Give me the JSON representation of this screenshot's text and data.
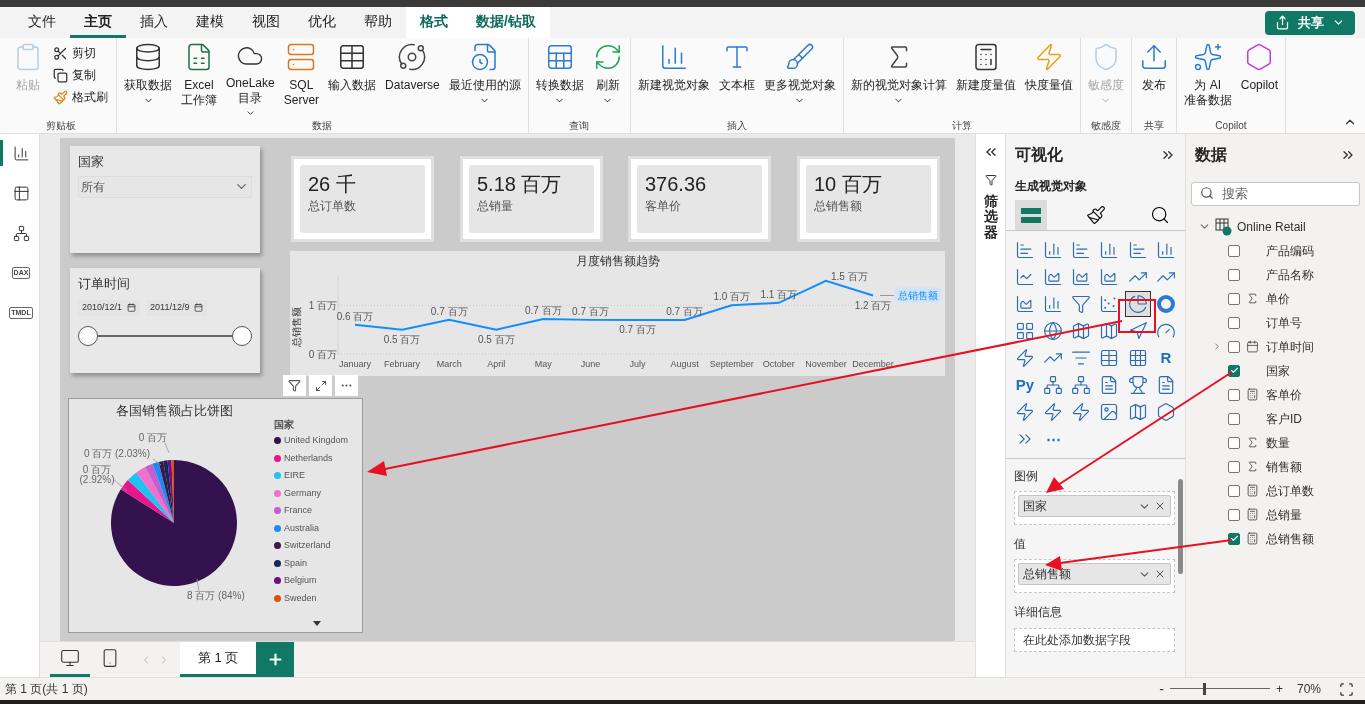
{
  "ribbon_tabs": [
    {
      "label": "文件",
      "kind": "normal",
      "selected": false
    },
    {
      "label": "主页",
      "kind": "normal",
      "selected": true
    },
    {
      "label": "插入",
      "kind": "normal",
      "selected": false
    },
    {
      "label": "建模",
      "kind": "normal",
      "selected": false
    },
    {
      "label": "视图",
      "kind": "normal",
      "selected": false
    },
    {
      "label": "优化",
      "kind": "normal",
      "selected": false
    },
    {
      "label": "帮助",
      "kind": "normal",
      "selected": false
    },
    {
      "label": "格式",
      "kind": "contextual",
      "selected": false
    },
    {
      "label": "数据/钻取",
      "kind": "contextual",
      "selected": false
    }
  ],
  "share_button": {
    "label": "共享"
  },
  "ribbon_groups": [
    {
      "label": "剪贴板",
      "buttons": [
        {
          "label": "粘贴",
          "kind": "large",
          "dropdown": false,
          "disabled": true
        },
        {
          "label": "剪切",
          "kind": "small",
          "dropdown": false,
          "disabled": false
        },
        {
          "label": "复制",
          "kind": "small",
          "dropdown": false,
          "disabled": false
        },
        {
          "label": "格式刷",
          "kind": "small",
          "dropdown": false,
          "disabled": false
        }
      ]
    },
    {
      "label": "数据",
      "buttons": [
        {
          "label": "获取数据",
          "kind": "large",
          "dropdown": true,
          "disabled": false
        },
        {
          "label": "Excel\n工作簿",
          "kind": "large",
          "dropdown": false,
          "disabled": false
        },
        {
          "label": "OneLake\n目录",
          "kind": "large",
          "dropdown": true,
          "disabled": false
        },
        {
          "label": "SQL\nServer",
          "kind": "large",
          "dropdown": false,
          "disabled": false
        },
        {
          "label": "输入数据",
          "kind": "large",
          "dropdown": false,
          "disabled": false
        },
        {
          "label": "Dataverse",
          "kind": "large",
          "dropdown": false,
          "disabled": false
        },
        {
          "label": "最近使用的源",
          "kind": "large",
          "dropdown": true,
          "disabled": false
        }
      ]
    },
    {
      "label": "查询",
      "buttons": [
        {
          "label": "转换数据",
          "kind": "large",
          "dropdown": true,
          "disabled": false
        },
        {
          "label": "刷新",
          "kind": "large",
          "dropdown": true,
          "disabled": false
        }
      ]
    },
    {
      "label": "插入",
      "buttons": [
        {
          "label": "新建视觉对象",
          "kind": "large",
          "dropdown": false,
          "disabled": false
        },
        {
          "label": "文本框",
          "kind": "large",
          "dropdown": false,
          "disabled": false
        },
        {
          "label": "更多视觉对象",
          "kind": "large",
          "dropdown": true,
          "disabled": false
        }
      ]
    },
    {
      "label": "计算",
      "buttons": [
        {
          "label": "新的视觉对象计算",
          "kind": "large",
          "dropdown": true,
          "disabled": false
        },
        {
          "label": "新建度量值",
          "kind": "large",
          "dropdown": false,
          "disabled": false
        },
        {
          "label": "快度量值",
          "kind": "large",
          "dropdown": false,
          "disabled": false
        }
      ]
    },
    {
      "label": "敏感度",
      "buttons": [
        {
          "label": "敏感度",
          "kind": "large",
          "dropdown": true,
          "disabled": true
        }
      ]
    },
    {
      "label": "共享",
      "buttons": [
        {
          "label": "发布",
          "kind": "large",
          "dropdown": false,
          "disabled": false
        }
      ]
    },
    {
      "label": "Copilot",
      "buttons": [
        {
          "label": "为 AI\n准备数据",
          "kind": "large",
          "dropdown": false,
          "disabled": false
        },
        {
          "label": "Copilot",
          "kind": "large",
          "dropdown": false,
          "disabled": false
        }
      ]
    }
  ],
  "view_rail": [
    {
      "kind": "report",
      "selected": true
    },
    {
      "kind": "table",
      "selected": false
    },
    {
      "kind": "model",
      "selected": false
    },
    {
      "kind": "dax",
      "label": "DAX",
      "selected": false
    },
    {
      "kind": "tmdl",
      "label": "TMDL",
      "selected": false
    }
  ],
  "slicers": [
    {
      "kind": "dropdown",
      "title": "国家",
      "value": "所有"
    },
    {
      "kind": "range",
      "title": "订单时间",
      "start": "2010/12/1",
      "end": "2011/12/9",
      "handles": [
        {
          "level": 0
        },
        {
          "level": 1
        }
      ]
    }
  ],
  "cards": [
    {
      "value": "26 千",
      "label": "总订单数"
    },
    {
      "value": "5.18 百万",
      "label": "总销量"
    },
    {
      "value": "376.36",
      "label": "客单价"
    },
    {
      "value": "10 百万",
      "label": "总销售额"
    }
  ],
  "line_chart": {
    "chart_data": {
      "type": "line",
      "title": "月度销售额趋势",
      "ylabel": "总销售额",
      "categories": [
        "January",
        "February",
        "March",
        "April",
        "May",
        "June",
        "July",
        "August",
        "September",
        "October",
        "November",
        "December"
      ],
      "series": [
        {
          "name": "总销售额",
          "color": "#118dff",
          "values": [
            0.6,
            0.5,
            0.7,
            0.5,
            0.72,
            0.7,
            0.7,
            0.7,
            1.0,
            1.05,
            1.5,
            1.2
          ]
        }
      ],
      "ylim": [
        0,
        1.6
      ],
      "yticks": [
        {
          "value": 0,
          "label": "0 百万"
        },
        {
          "value": 1,
          "label": "1 百万"
        }
      ],
      "value_labels": [
        "0.6 百万",
        "0.5 百万",
        "0.7 百万",
        "0.5 百万",
        "0.7 百万",
        "0.7 百万",
        "0.7 百万",
        "0.7 百万",
        "1.0 百万",
        "1.1 百万",
        "1.5 百万",
        "1.2 百万"
      ]
    }
  },
  "pie_chart": {
    "slices": [
      {
        "color": "#34124e"
      },
      {
        "color": "#e8158c"
      },
      {
        "color": "#1fc3ef"
      },
      {
        "color": "#f46fcb"
      },
      {
        "color": "#c15fcf"
      },
      {
        "color": "#1a8cf5"
      },
      {
        "color": "#3e1746"
      },
      {
        "color": "#0e2a55"
      },
      {
        "color": "#6f0a8a"
      },
      {
        "color": "#d9530c"
      }
    ],
    "chart_data": {
      "type": "pie",
      "title": "各国销售额占比饼图",
      "legend": {
        "title": "国家"
      },
      "categories": [
        "United Kingdom",
        "Netherlands",
        "EIRE",
        "Germany",
        "France",
        "Australia",
        "Switzerland",
        "Spain",
        "Belgium",
        "Sweden"
      ],
      "values": [
        84,
        2.92,
        2.9,
        2.6,
        2.03,
        1.6,
        1.2,
        1.1,
        1.0,
        0.65
      ],
      "annotations": [
        "8 百万 (84%)",
        "0 百万\n(2.92%)",
        "0 百万 (2.03%)",
        "0 百万"
      ]
    }
  },
  "filter_pane": {
    "label": "筛选器"
  },
  "visualizations_pane": {
    "title": "可视化",
    "section_title": "生成视觉对象",
    "mode_tabs": [
      {
        "kind": "build",
        "selected": true
      },
      {
        "kind": "format",
        "selected": false
      },
      {
        "kind": "analytics",
        "selected": false
      }
    ],
    "gallery": [
      {
        "kind": "hbar",
        "selected": false
      },
      {
        "kind": "column",
        "selected": false
      },
      {
        "kind": "hbar",
        "selected": false
      },
      {
        "kind": "column",
        "selected": false
      },
      {
        "kind": "hbar",
        "selected": false
      },
      {
        "kind": "column",
        "selected": false
      },
      {
        "kind": "line",
        "selected": false
      },
      {
        "kind": "area",
        "selected": false
      },
      {
        "kind": "area",
        "selected": false
      },
      {
        "kind": "area",
        "selected": false
      },
      {
        "kind": "combo",
        "selected": false
      },
      {
        "kind": "combo",
        "selected": false
      },
      {
        "kind": "area",
        "selected": false
      },
      {
        "kind": "column",
        "selected": false
      },
      {
        "kind": "funnel",
        "selected": false
      },
      {
        "kind": "scatter",
        "selected": false
      },
      {
        "kind": "pie",
        "selected": true
      },
      {
        "kind": "donut",
        "selected": false
      },
      {
        "kind": "treemap",
        "selected": false
      },
      {
        "kind": "globe",
        "selected": false
      },
      {
        "kind": "map",
        "selected": false
      },
      {
        "kind": "map",
        "selected": false
      },
      {
        "kind": "navigation",
        "selected": false
      },
      {
        "kind": "gauge",
        "selected": false
      },
      {
        "kind": "lightning",
        "selected": false
      },
      {
        "kind": "kpi",
        "selected": false
      },
      {
        "kind": "slicer",
        "selected": false
      },
      {
        "kind": "table",
        "selected": false
      },
      {
        "kind": "matrix",
        "selected": false
      },
      {
        "kind": "glyph",
        "label": "R",
        "selected": false
      },
      {
        "kind": "glyph",
        "label": "Py",
        "selected": false
      },
      {
        "kind": "tree",
        "selected": false
      },
      {
        "kind": "tree",
        "selected": false
      },
      {
        "kind": "document",
        "selected": false
      },
      {
        "kind": "trophy",
        "selected": false
      },
      {
        "kind": "document",
        "selected": false
      },
      {
        "kind": "lightning",
        "selected": false
      },
      {
        "kind": "lightning",
        "selected": false
      },
      {
        "kind": "lightning",
        "selected": false
      },
      {
        "kind": "image",
        "selected": false
      },
      {
        "kind": "map",
        "selected": false
      },
      {
        "kind": "hexagon",
        "selected": false
      },
      {
        "kind": "chevrons",
        "selected": false
      },
      {
        "kind": "glyph",
        "label": "⋯",
        "selected": false
      }
    ],
    "wells": [
      {
        "label": "图例",
        "field": "国家"
      },
      {
        "label": "值",
        "field": "总销售额"
      },
      {
        "label": "详细信息",
        "placeholder": "在此处添加数据字段"
      }
    ]
  },
  "data_pane": {
    "title": "数据",
    "search_placeholder": "搜索",
    "table": {
      "name": "Online Retail",
      "expanded": true,
      "fields": [
        {
          "name": "产品编码",
          "kind": "column",
          "checked": false
        },
        {
          "name": "产品名称",
          "kind": "column",
          "checked": false
        },
        {
          "name": "单价",
          "kind": "sum",
          "checked": false
        },
        {
          "name": "订单号",
          "kind": "column",
          "checked": false
        },
        {
          "name": "订单时间",
          "kind": "date",
          "checked": false,
          "expanded": false
        },
        {
          "name": "国家",
          "kind": "column",
          "checked": true
        },
        {
          "name": "客单价",
          "kind": "measure",
          "checked": false
        },
        {
          "name": "客户ID",
          "kind": "column",
          "checked": false
        },
        {
          "name": "数量",
          "kind": "sum",
          "checked": false
        },
        {
          "name": "销售额",
          "kind": "sum",
          "checked": false
        },
        {
          "name": "总订单数",
          "kind": "measure",
          "checked": false
        },
        {
          "name": "总销量",
          "kind": "measure",
          "checked": false
        },
        {
          "name": "总销售额",
          "kind": "measure",
          "checked": true
        }
      ]
    }
  },
  "page_bar": {
    "views": [
      {
        "kind": "desktop",
        "selected": true
      },
      {
        "kind": "mobile",
        "selected": false
      }
    ],
    "pages": [
      {
        "label": "第 1 页",
        "selected": true
      }
    ]
  },
  "status_bar": {
    "page_info": "第 1 页(共 1 页)",
    "zoom_out": "-",
    "zoom_in": "+",
    "zoom": {
      "level": 0.34,
      "reading": "70%"
    }
  }
}
